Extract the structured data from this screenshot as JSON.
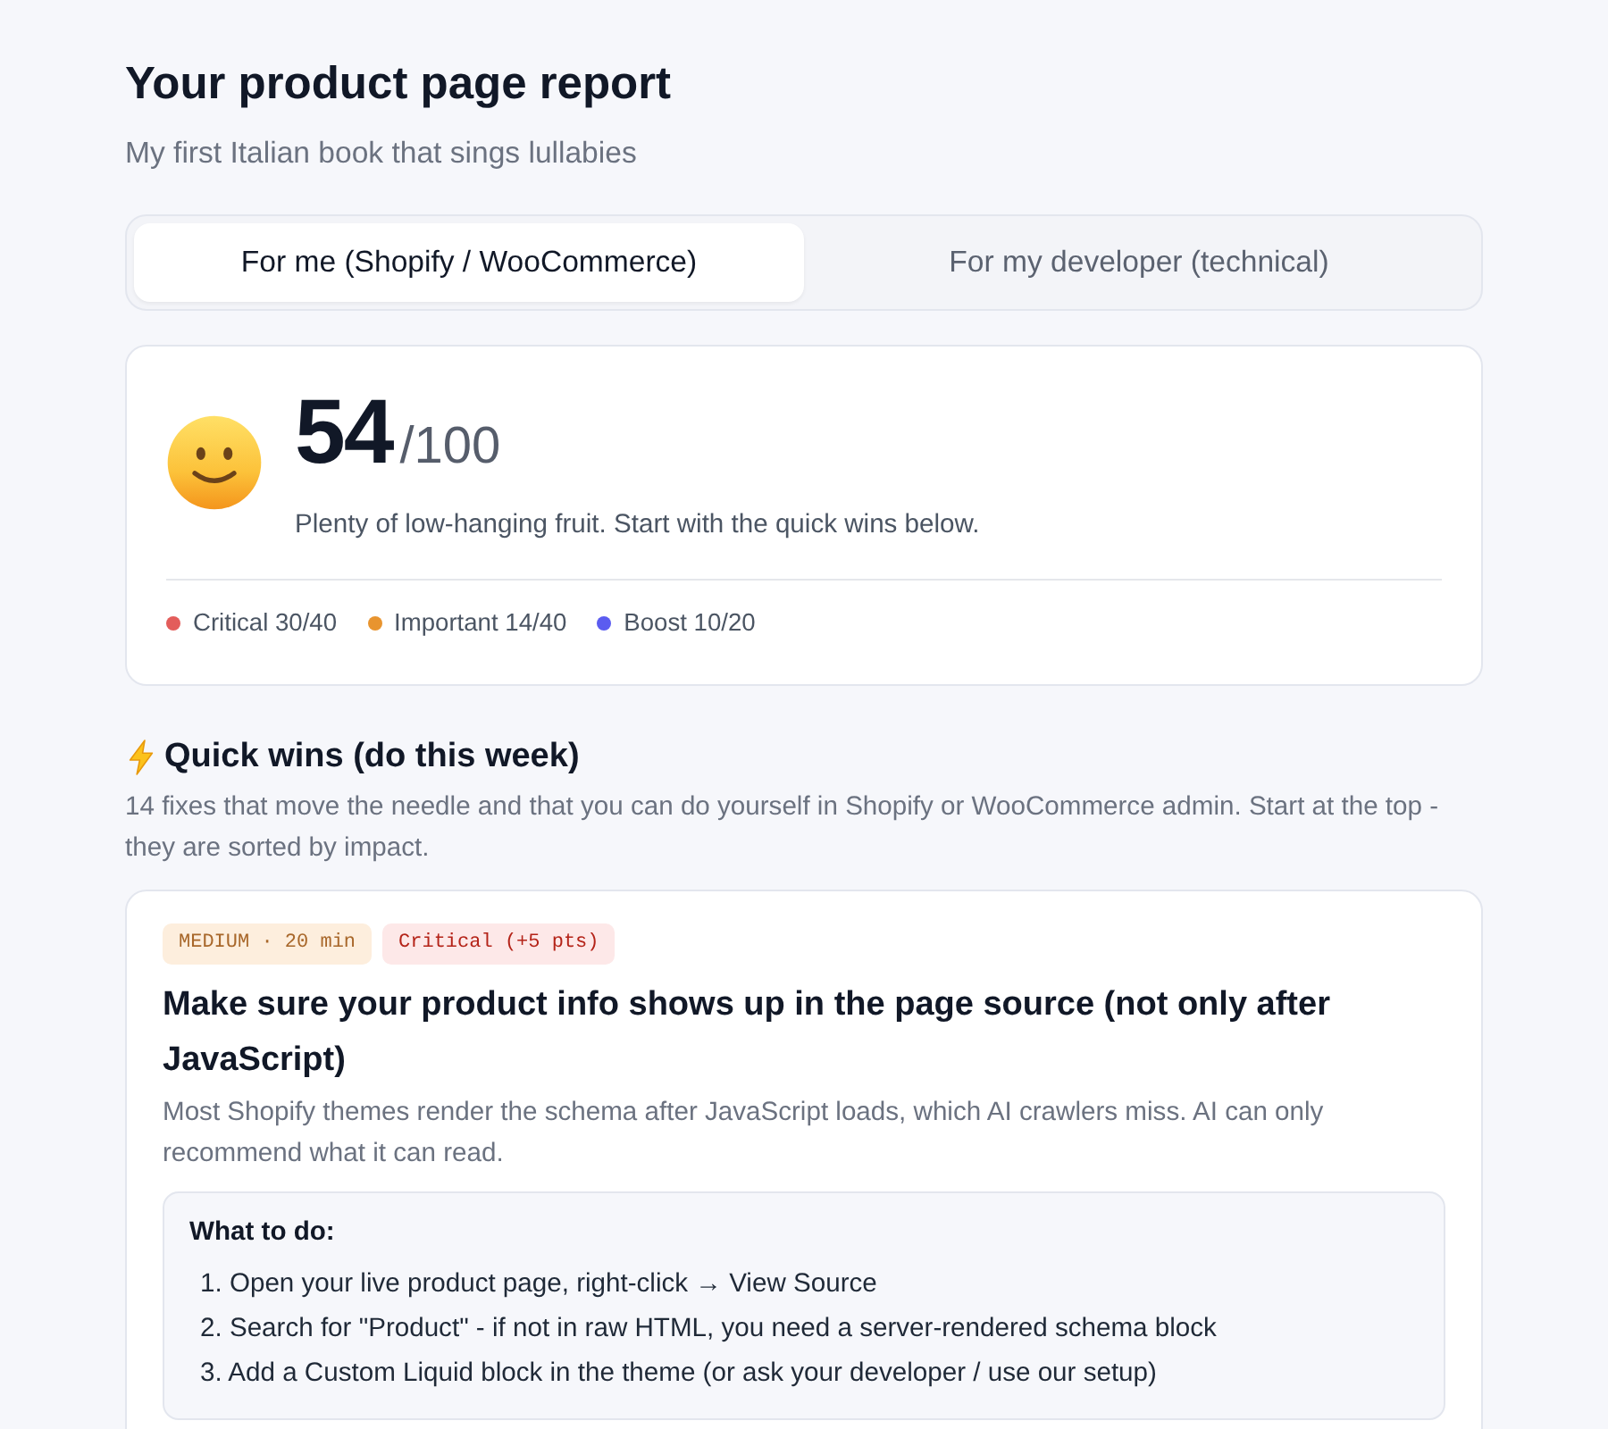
{
  "header": {
    "title": "Your product page report",
    "subtitle": "My first Italian book that sings lullabies"
  },
  "tabs": [
    {
      "label": "For me (Shopify / WooCommerce)",
      "selected": true
    },
    {
      "label": "For my developer (technical)",
      "selected": false
    }
  ],
  "score": {
    "value": "54",
    "max": "/100",
    "summary": "Plenty of low-hanging fruit. Start with the quick wins below.",
    "legend": [
      {
        "label": "Critical 30/40",
        "color": "#e35d5b"
      },
      {
        "label": "Important 14/40",
        "color": "#e8942f"
      },
      {
        "label": "Boost 10/20",
        "color": "#5b5cf0"
      }
    ]
  },
  "quick_wins": {
    "title": "Quick wins (do this week)",
    "description": "14 fixes that move the needle and that you can do yourself in Shopify or WooCommerce admin. Start at the top - they are sorted by impact.",
    "fixes": [
      {
        "badges": [
          {
            "kind": "effort",
            "label": "MEDIUM · 20 min"
          },
          {
            "kind": "severity",
            "label": "Critical (+5 pts)"
          }
        ],
        "title": "Make sure your product info shows up in the page source (not only after JavaScript)",
        "description": "Most Shopify themes render the schema after JavaScript loads, which AI crawlers miss. AI can only recommend what it can read.",
        "steps_title": "What to do:",
        "steps": [
          "1. Open your live product page, right-click → View Source",
          "2. Search for \"Product\" - if not in raw HTML, you need a server-rendered schema block",
          "3. Add a Custom Liquid block in the theme (or ask your developer / use our setup)"
        ]
      }
    ]
  }
}
